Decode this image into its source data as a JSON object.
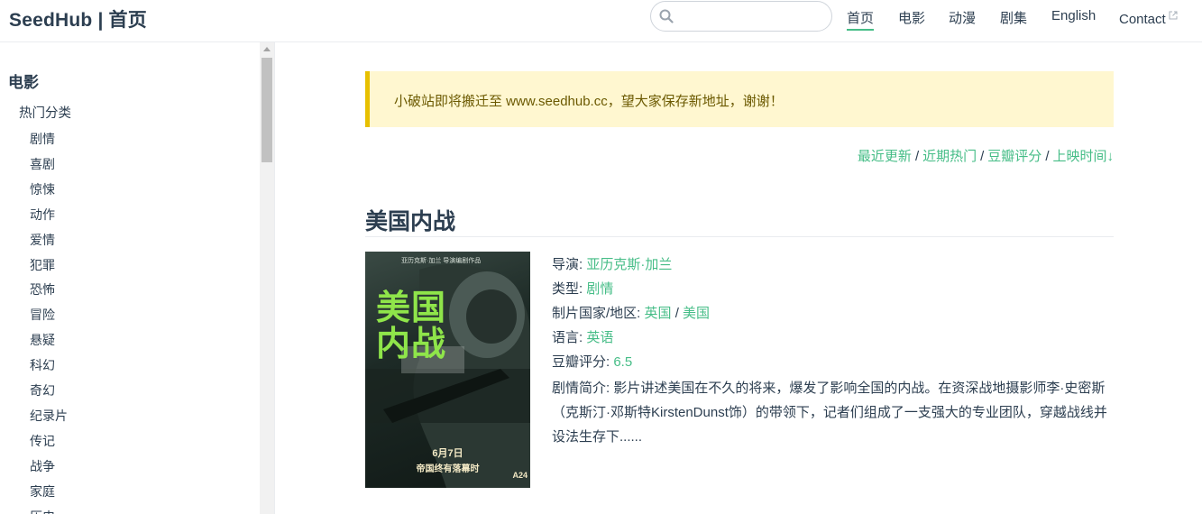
{
  "header": {
    "site_name": "SeedHub | 首页",
    "search": {
      "placeholder": "",
      "value": ""
    },
    "nav": [
      {
        "label": "首页",
        "active": true
      },
      {
        "label": "电影"
      },
      {
        "label": "动漫"
      },
      {
        "label": "剧集"
      },
      {
        "label": "English"
      },
      {
        "label": "Contact",
        "external": true
      }
    ]
  },
  "sidebar": {
    "heading": "电影",
    "group": "热门分类",
    "items": [
      "剧情",
      "喜剧",
      "惊悚",
      "动作",
      "爱情",
      "犯罪",
      "恐怖",
      "冒险",
      "悬疑",
      "科幻",
      "奇幻",
      "纪录片",
      "传记",
      "战争",
      "家庭",
      "历史"
    ]
  },
  "notice": "小破站即将搬迁至 www.seedhub.cc，望大家保存新地址，谢谢！",
  "sort": {
    "links": [
      "最近更新",
      "近期热门",
      "豆瓣评分",
      "上映时间↓"
    ],
    "separator": "/"
  },
  "movie": {
    "title": "美国内战",
    "poster": {
      "title_line1": "美国",
      "title_line2": "内战",
      "top_text": "亚历克斯·加兰  导演编剧作品",
      "date": "6月7日",
      "subtitle": "帝国终有落幕时",
      "studio": "A24"
    },
    "director_label": "导演:",
    "director": "亚历克斯·加兰",
    "genre_label": "类型:",
    "genre": "剧情",
    "region_label": "制片国家/地区:",
    "regions": [
      "英国",
      "美国"
    ],
    "language_label": "语言:",
    "language": "英语",
    "rating_label": "豆瓣评分:",
    "rating": "6.5",
    "plot_label": "剧情简介:",
    "plot": "影片讲述美国在不久的将来，爆发了影响全国的内战。在资深战地摄影师李·史密斯（克斯汀·邓斯特KirstenDunst饰）的带领下，记者们组成了一支强大的专业团队，穿越战线并设法生存下......"
  },
  "colors": {
    "accent": "#46bd87",
    "notice_bg": "#fff7d0",
    "notice_border": "#e7c000",
    "text": "#2c3e50"
  }
}
